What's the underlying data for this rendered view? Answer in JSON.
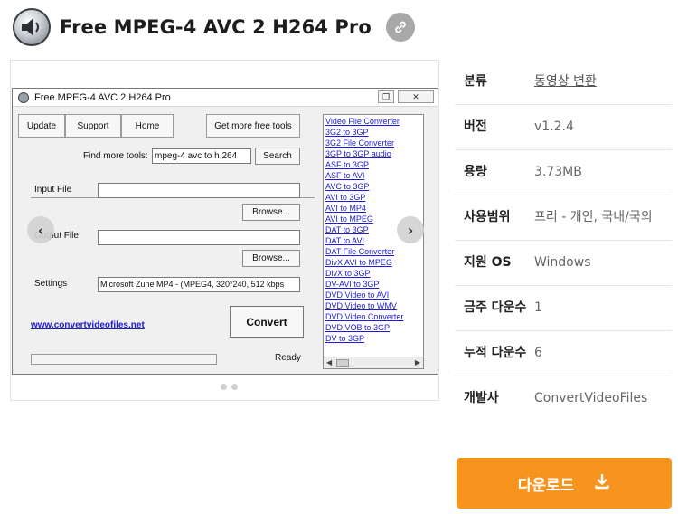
{
  "header": {
    "title": "Free MPEG-4 AVC 2 H264 Pro"
  },
  "screenshot": {
    "window_title": "Free MPEG-4 AVC 2 H264 Pro",
    "tabs": [
      "Update",
      "Support",
      "Home"
    ],
    "get_more_tools": "Get more free tools",
    "find_more_label": "Find more tools:",
    "find_more_value": "mpeg-4 avc to h.264",
    "search_label": "Search",
    "input_file_label": "Input File",
    "output_file_label": "Output File",
    "browse_label": "Browse...",
    "settings_label": "Settings",
    "settings_value": "Microsoft Zune MP4 - (MPEG4, 320*240, 512 kbps",
    "website": "www.convertvideofiles.net",
    "convert_label": "Convert",
    "status": "Ready",
    "links": [
      "Video File Converter",
      "3G2 to 3GP",
      "3G2 File Converter",
      "3GP to 3GP audio",
      "ASF to 3GP",
      "ASF to AVI",
      "AVC to 3GP",
      "AVI to 3GP",
      "AVI to MP4",
      "AVI to MPEG",
      "DAT to 3GP",
      "DAT to AVI",
      "DAT File Converter",
      "DivX AVI to MPEG",
      "DivX to 3GP",
      "DV-AVI to 3GP",
      "DVD Video to AVI",
      "DVD Video to WMV",
      "DVD Video Converter",
      "DVD VOB to 3GP",
      "DV to 3GP"
    ]
  },
  "info": {
    "category_label": "분류",
    "category_value": "동영상 변환",
    "version_label": "버전",
    "version_value": "v1.2.4",
    "size_label": "용량",
    "size_value": "3.73MB",
    "license_label": "사용범위",
    "license_value": "프리 - 개인, 국내/국외",
    "os_label": "지원 OS",
    "os_value": "Windows",
    "weekly_label": "금주 다운수",
    "weekly_value": "1",
    "total_label": "누적 다운수",
    "total_value": "6",
    "developer_label": "개발사",
    "developer_value": "ConvertVideoFiles"
  },
  "download": {
    "label": "다운로드"
  },
  "colors": {
    "accent": "#f7941d",
    "link_blue": "#1b1bd8"
  },
  "icons": [
    "app-icon",
    "link-icon",
    "chevron-left-icon",
    "chevron-right-icon",
    "download-icon"
  ]
}
